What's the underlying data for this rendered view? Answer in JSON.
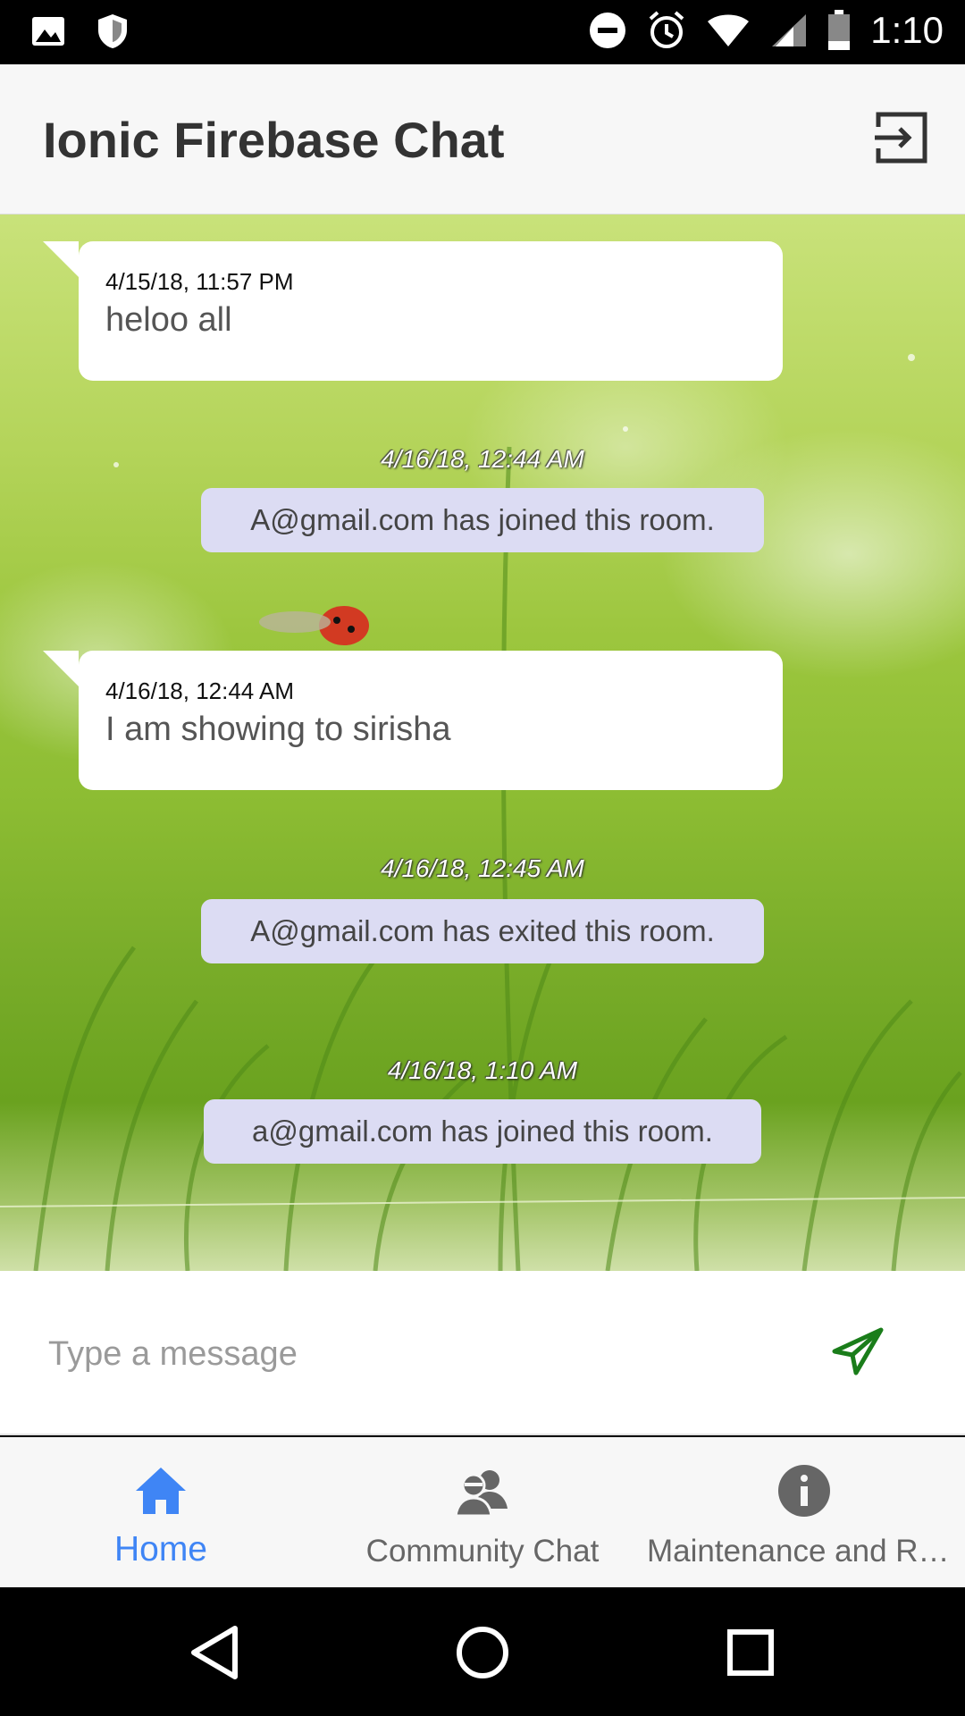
{
  "status_bar": {
    "time": "1:10",
    "icons": [
      "image-icon",
      "shield-icon",
      "do-not-disturb-icon",
      "alarm-icon",
      "wifi-icon",
      "signal-icon",
      "battery-icon"
    ]
  },
  "header": {
    "title": "Ionic Firebase Chat",
    "logout_icon": "logout-icon"
  },
  "messages": [
    {
      "type": "user",
      "time": "4/15/18, 11:57 PM",
      "text": "heloo all"
    },
    {
      "type": "system",
      "time": "4/16/18, 12:44 AM",
      "text": "A@gmail.com has joined this room."
    },
    {
      "type": "user",
      "time": "4/16/18, 12:44 AM",
      "text": "I am showing to sirisha"
    },
    {
      "type": "system",
      "time": "4/16/18, 12:45 AM",
      "text": "A@gmail.com has exited this room."
    },
    {
      "type": "system",
      "time": "4/16/18, 1:10 AM",
      "text": "a@gmail.com has joined this room."
    }
  ],
  "input": {
    "placeholder": "Type a message",
    "value": "",
    "send_icon": "send-icon",
    "send_color": "#1a7d1a"
  },
  "tabs": [
    {
      "label": "Home",
      "icon": "home-icon",
      "active": true
    },
    {
      "label": "Community Chat",
      "icon": "community-chat-icon",
      "active": false
    },
    {
      "label": "Maintenance and Re...",
      "icon": "info-icon",
      "active": false
    }
  ],
  "colors": {
    "accent": "#3f85f5",
    "system_note_bg": "#dcdcf3",
    "header_bg": "#f7f7f7"
  },
  "nav_bar": {
    "icons": [
      "back-icon",
      "home-circle-icon",
      "recents-icon"
    ]
  }
}
